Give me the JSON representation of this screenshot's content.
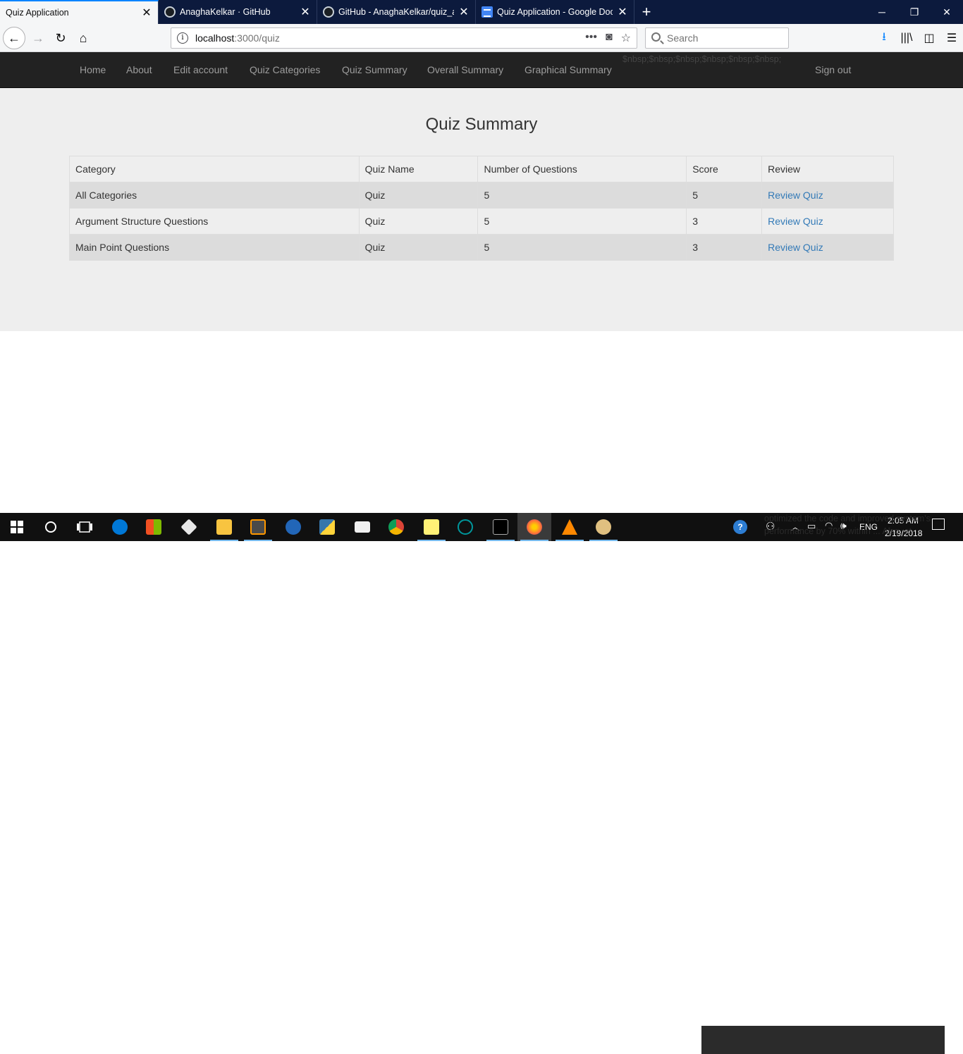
{
  "browser": {
    "tabs": [
      {
        "title": "Quiz Application",
        "active": true
      },
      {
        "title": "AnaghaKelkar · GitHub",
        "active": false
      },
      {
        "title": "GitHub - AnaghaKelkar/quiz_ap",
        "active": false
      },
      {
        "title": "Quiz Application - Google Docs",
        "active": false
      }
    ],
    "url_host": "localhost",
    "url_path": ":3000/quiz",
    "search_placeholder": "Search"
  },
  "app_nav": {
    "links": [
      "Home",
      "About",
      "Edit account",
      "Quiz Categories",
      "Quiz Summary",
      "Overall Summary",
      "Graphical Summary"
    ],
    "stray_text": "$nbsp;$nbsp;$nbsp;$nbsp;$nbsp;$nbsp;",
    "sign_out": "Sign out"
  },
  "page": {
    "title": "Quiz Summary"
  },
  "table": {
    "headers": [
      "Category",
      "Quiz Name",
      "Number of Questions",
      "Score",
      "Review"
    ],
    "rows": [
      {
        "category": "All Categories",
        "quiz_name": "Quiz",
        "questions": "5",
        "score": "5",
        "review": "Review Quiz"
      },
      {
        "category": "Argument Structure Questions",
        "quiz_name": "Quiz",
        "questions": "5",
        "score": "3",
        "review": "Review Quiz"
      },
      {
        "category": "Main Point Questions",
        "quiz_name": "Quiz",
        "questions": "5",
        "score": "3",
        "review": "Review Quiz"
      }
    ]
  },
  "taskbar": {
    "time": "2:05 AM",
    "date": "2/19/2018",
    "language": "ENG",
    "overlay_line1": "optimized the code and improved system's",
    "overlay_line2": "performance by 70% within ... Also, at"
  },
  "colors": {
    "navbar_bg": "#222222",
    "link_blue": "#337ab7",
    "main_bg": "#eeeeee"
  }
}
